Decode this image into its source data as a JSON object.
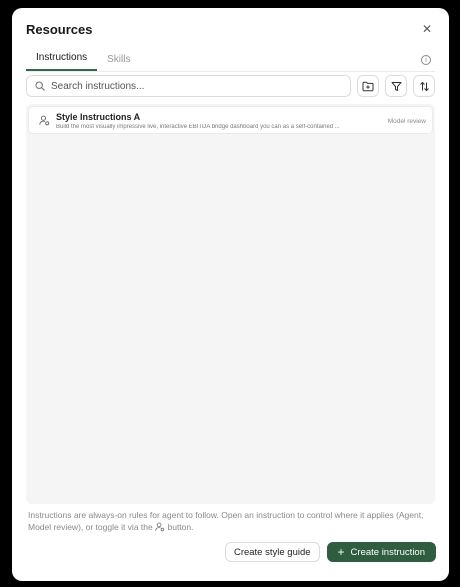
{
  "dialog": {
    "title": "Resources",
    "close_icon": "close-icon"
  },
  "tabs": [
    {
      "label": "Instructions",
      "active": true
    },
    {
      "label": "Skills",
      "active": false
    }
  ],
  "search": {
    "placeholder": "Search instructions...",
    "value": ""
  },
  "toolbar": {
    "icons": [
      "folder-plus-icon",
      "filter-icon",
      "sort-icon"
    ]
  },
  "items": [
    {
      "name": "Style Instructions A",
      "description": "Build the most visually impressive live, interactive EBITDA bridge dashboard you can as a self-contained ...",
      "badge": "Model review",
      "icon": "user-settings-icon"
    }
  ],
  "footnote": {
    "before_icon": "Instructions are always-on rules for agent to follow. Open an instruction to control where it applies (Agent, Model review), or toggle it via the",
    "after_icon": "button."
  },
  "buttons": {
    "style_guide": "Create style guide",
    "create_instruction": "Create instruction"
  },
  "colors": {
    "accent": "#2f5d3f",
    "list_bg": "#f5f5f5"
  }
}
